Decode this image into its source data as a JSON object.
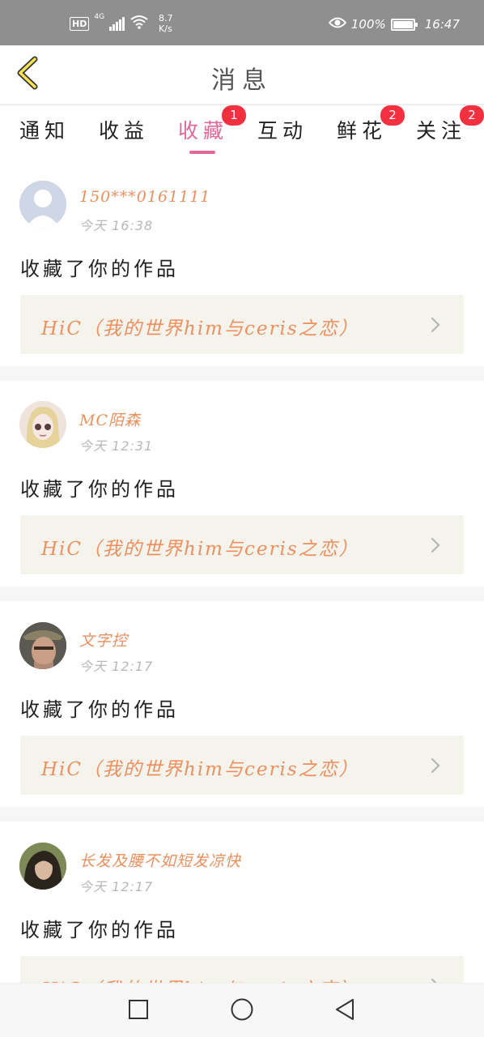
{
  "status_bar": {
    "hd": "HD",
    "network": "4G",
    "speed_value": "8.7",
    "speed_unit": "K/s",
    "battery": "100%",
    "time": "16:47"
  },
  "header": {
    "title": "消息"
  },
  "tabs": [
    {
      "label": "通知",
      "badge": ""
    },
    {
      "label": "收益",
      "badge": ""
    },
    {
      "label": "收藏",
      "badge": "1",
      "active": true
    },
    {
      "label": "互动",
      "badge": ""
    },
    {
      "label": "鲜花",
      "badge": "2"
    },
    {
      "label": "关注",
      "badge": "2"
    }
  ],
  "accent_color": "#e0689a",
  "badge_color": "#f2303f",
  "items": [
    {
      "user": "150***0161111",
      "time": "今天 16:38",
      "action": "收藏了你的作品",
      "work": "HiC（我的世界him与ceris之恋）",
      "avatar": "default-avatar"
    },
    {
      "user": "MC陌森",
      "time": "今天 12:31",
      "action": "收藏了你的作品",
      "work": "HiC（我的世界him与ceris之恋）",
      "avatar": "drawn-character-avatar"
    },
    {
      "user": "文字控",
      "time": "今天 12:17",
      "action": "收藏了你的作品",
      "work": "HiC（我的世界him与ceris之恋）",
      "avatar": "photo-avatar-man-hat"
    },
    {
      "user": "长发及腰不如短发凉快",
      "time": "今天 12:17",
      "action": "收藏了你的作品",
      "work": "HiC（我的世界him与ceris之恋）",
      "avatar": "photo-avatar-woman"
    }
  ]
}
